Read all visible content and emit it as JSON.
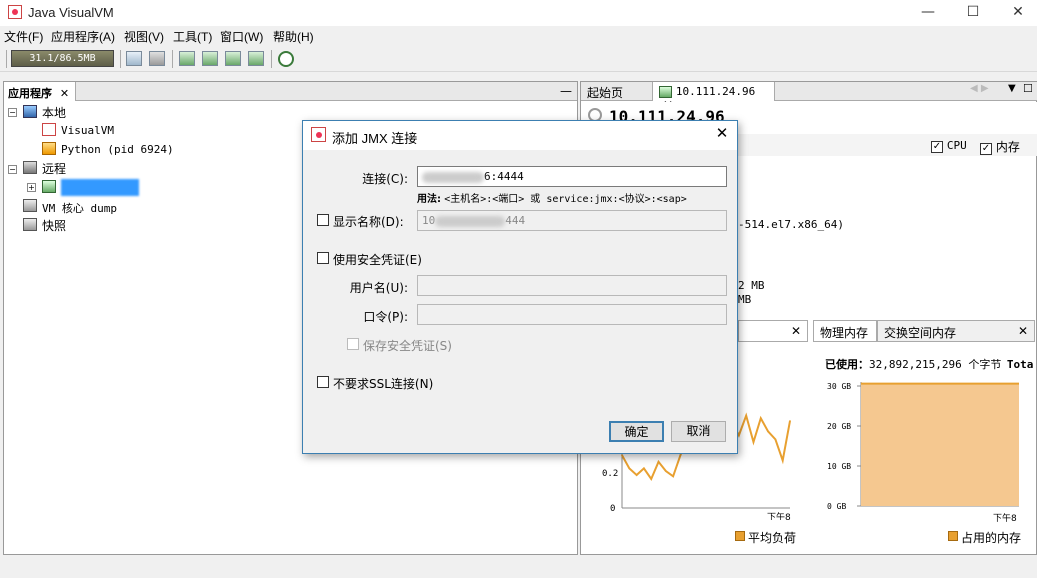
{
  "window": {
    "title": "Java VisualVM",
    "minimize": "—",
    "maximize": "☐",
    "close": "✕"
  },
  "menu": [
    "文件(F)",
    "应用程序(A)",
    "视图(V)",
    "工具(T)",
    "窗口(W)",
    "帮助(H)"
  ],
  "toolbar": {
    "memory": "31.1/86.5MB"
  },
  "left_panel": {
    "tab": "应用程序",
    "tab_close": "✕",
    "minimize": "—",
    "tree": {
      "local": "本地",
      "visualvm": "VisualVM",
      "python": "Python (pid 6924)",
      "remote": "远程",
      "vm_core": "VM 核心 dump",
      "snapshot": "快照"
    }
  },
  "right_panel": {
    "tabs": [
      "起始页",
      "10.111.24.96"
    ],
    "tab_close": "✕",
    "header_title": "10.111.24.96",
    "checkbox_cpu": "CPU",
    "checkbox_mem": "内存",
    "info_os": "-514.el7.x86_64)",
    "info_mem1": "2 MB",
    "info_mem2": "MB",
    "subtab_close": "✕",
    "subtabs": [
      "物理内存",
      "交换空间内存"
    ],
    "used_label": "已使用：",
    "used_value": "32,892,215,296 个字节",
    "total_label": "Tota",
    "left_chart": {
      "ylabel_02": "0.2",
      "ylabel_0": "0",
      "xlabel": "下午8",
      "legend": "平均负荷"
    },
    "right_chart": {
      "yticks": [
        "30 GB",
        "20 GB",
        "10 GB",
        "0 GB"
      ],
      "xlabel": "下午8",
      "legend": "占用的内存"
    }
  },
  "dialog": {
    "title": "添加 JMX 连接",
    "close": "✕",
    "connection_label": "连接(C):",
    "connection_value": "6:4444",
    "usage_bold": "用法:",
    "usage_text": "<主机名>:<端口> 或 service:jmx:<协议>:<sap>",
    "display_name_label": "显示名称(D):",
    "display_name_prefix": "10",
    "display_name_suffix": "444",
    "use_security": "使用安全凭证(E)",
    "username_label": "用户名(U):",
    "password_label": "口令(P):",
    "save_security": "保存安全凭证(S)",
    "no_ssl": "不要求SSL连接(N)",
    "ok": "确定",
    "cancel": "取消"
  },
  "colors": {
    "accent": "#3c7fb1",
    "chart_line": "#e8a030",
    "selection": "#3399ff"
  },
  "chart_data": [
    {
      "type": "line",
      "title": "",
      "legend": [
        "平均负荷"
      ],
      "x": [
        "",
        "",
        "",
        "",
        "",
        "",
        "",
        "",
        "",
        "",
        "",
        "",
        "",
        "",
        "",
        "",
        "",
        "",
        "",
        "",
        "",
        "",
        "",
        "下午8"
      ],
      "series": [
        {
          "name": "平均负荷",
          "values": [
            0.4,
            0.3,
            0.25,
            0.3,
            0.22,
            0.35,
            0.28,
            0.24,
            0.4,
            0.55,
            0.45,
            0.6,
            0.5,
            0.62,
            0.48,
            0.66,
            0.55,
            0.7,
            0.5,
            0.68,
            0.58,
            0.52,
            0.36,
            0.66
          ]
        }
      ],
      "ylim": [
        0,
        1
      ]
    },
    {
      "type": "area",
      "title": "",
      "legend": [
        "占用的内存"
      ],
      "x": [
        "",
        "下午8"
      ],
      "yticks": [
        "0 GB",
        "10 GB",
        "20 GB",
        "30 GB"
      ],
      "series": [
        {
          "name": "占用的内存",
          "values": [
            30.6,
            30.6
          ]
        }
      ],
      "ylim": [
        0,
        31
      ]
    }
  ]
}
